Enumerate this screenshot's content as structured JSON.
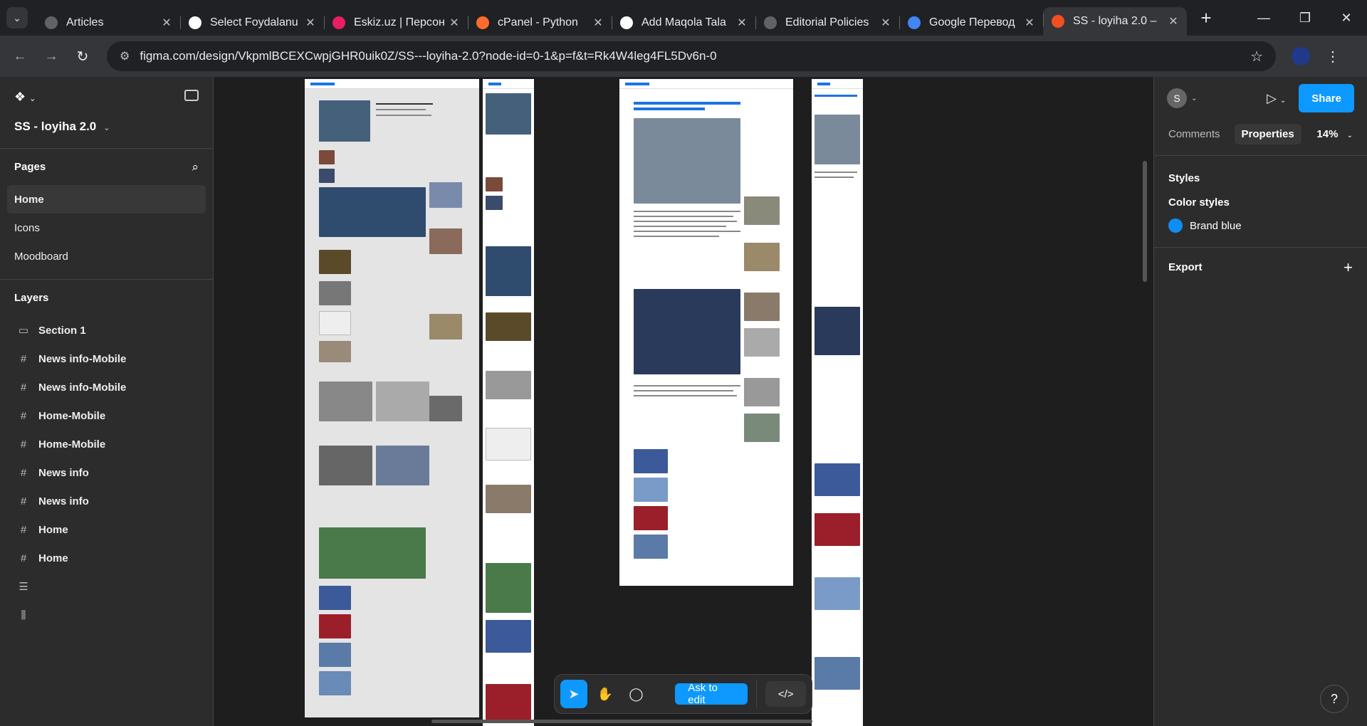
{
  "browser": {
    "tabs": [
      {
        "title": "Articles",
        "icon": "globe-icon",
        "color": "#5f6368"
      },
      {
        "title": "Select Foydalanu",
        "icon": "cms-icon",
        "color": "#ffffff"
      },
      {
        "title": "Eskiz.uz | Персон",
        "icon": "eskiz-icon",
        "color": "#e91e63"
      },
      {
        "title": "cPanel - Python",
        "icon": "cpanel-icon",
        "color": "#ff6c2c"
      },
      {
        "title": "Add Maqola Tala",
        "icon": "cms-icon",
        "color": "#ffffff"
      },
      {
        "title": "Editorial Policies",
        "icon": "globe-icon",
        "color": "#5f6368"
      },
      {
        "title": "Google Перевод",
        "icon": "translate-icon",
        "color": "#4285f4"
      },
      {
        "title": "SS - loyiha 2.0 –",
        "icon": "figma-icon",
        "color": "#f24e1e"
      }
    ],
    "url": "figma.com/design/VkpmlBCEXCwpjGHR0uik0Z/SS---loyiha-2.0?node-id=0-1&p=f&t=Rk4W4leg4FL5Dv6n-0"
  },
  "figma": {
    "project_title": "SS - loyiha 2.0",
    "pages_header": "Pages",
    "pages": [
      "Home",
      "Icons",
      "Moodboard"
    ],
    "active_page": "Home",
    "layers_header": "Layers",
    "layers": [
      {
        "name": "Section 1",
        "icon": "section-icon"
      },
      {
        "name": "News info-Mobile",
        "icon": "frame-icon"
      },
      {
        "name": "News info-Mobile",
        "icon": "frame-icon"
      },
      {
        "name": "Home-Mobile",
        "icon": "frame-icon"
      },
      {
        "name": "Home-Mobile",
        "icon": "frame-icon"
      },
      {
        "name": "News info",
        "icon": "frame-icon"
      },
      {
        "name": "News info",
        "icon": "frame-icon"
      },
      {
        "name": "Home",
        "icon": "frame-icon"
      },
      {
        "name": "Home",
        "icon": "frame-icon"
      },
      {
        "name": "",
        "icon": "auto-layout-icon"
      },
      {
        "name": "",
        "icon": "align-icon"
      }
    ],
    "right_panel": {
      "avatar_letter": "S",
      "share_label": "Share",
      "tabs": [
        "Comments",
        "Properties"
      ],
      "active_tab": "Properties",
      "zoom": "14%",
      "styles_header": "Styles",
      "color_styles_header": "Color styles",
      "color_styles": [
        {
          "name": "Brand blue",
          "color": "#0d8ff2"
        }
      ],
      "export_label": "Export"
    },
    "toolbar": {
      "ask_to_edit": "Ask to edit"
    },
    "help": "?"
  }
}
